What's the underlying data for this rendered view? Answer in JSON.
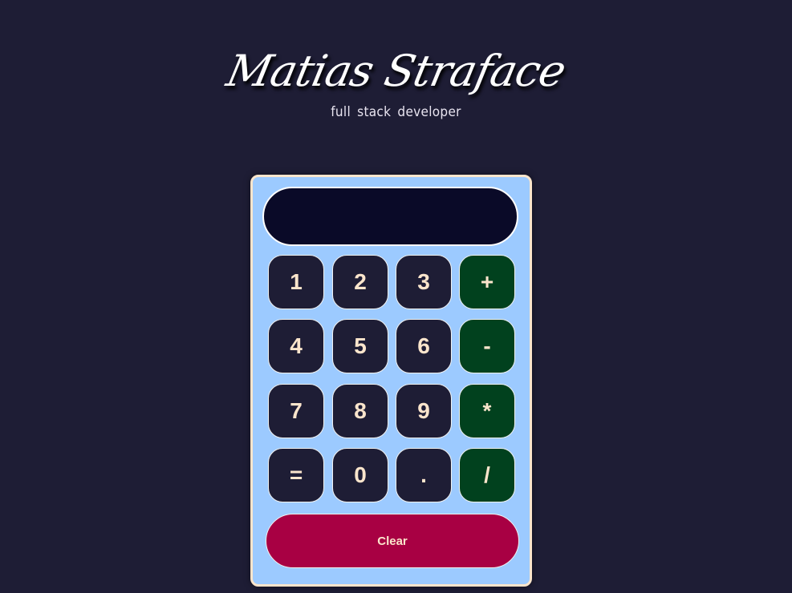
{
  "header": {
    "logo_text": "Matias Straface",
    "subtitle": "full stack developer"
  },
  "calculator": {
    "display_value": "",
    "keys": {
      "k1": "1",
      "k2": "2",
      "k3": "3",
      "plus": "+",
      "k4": "4",
      "k5": "5",
      "k6": "6",
      "minus": "-",
      "k7": "7",
      "k8": "8",
      "k9": "9",
      "multiply": "*",
      "equals": "=",
      "k0": "0",
      "dot": ".",
      "divide": "/"
    },
    "clear_label": "Clear"
  },
  "colors": {
    "page_background": "#1e1d35",
    "calculator_body": "#9ccaff",
    "calculator_border": "#fbe5cc",
    "display_background": "#0a0a28",
    "number_key": "#1e1d35",
    "operator_key": "#01411e",
    "clear_button": "#a80043",
    "key_text": "#fbe5cc"
  }
}
